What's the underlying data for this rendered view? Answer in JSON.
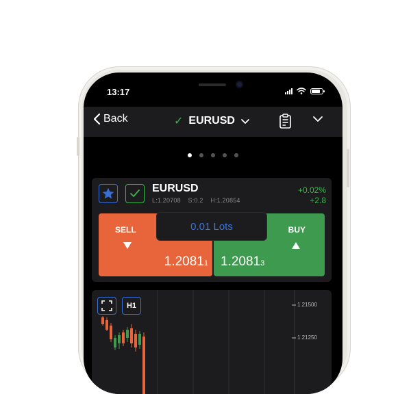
{
  "status": {
    "time": "13:17"
  },
  "nav": {
    "back_label": "Back",
    "symbol": "EURUSD"
  },
  "pager": {
    "count": 5,
    "active": 0
  },
  "card": {
    "symbol": "EURUSD",
    "low": "L:1.20708",
    "spread": "S:0.2",
    "high": "H:1.20854",
    "change_pct": "+0.02%",
    "change_pips": "+2.8",
    "sell_label": "SELL",
    "buy_label": "BUY",
    "sell_price_main": "1.2081",
    "sell_price_pip": "1",
    "buy_price_main": "1.2081",
    "buy_price_pip": "3",
    "lots": "0.01 Lots"
  },
  "chart": {
    "timeframe": "H1",
    "y_labels": [
      "1.21500",
      "1.21250"
    ]
  },
  "colors": {
    "sell": "#e8643a",
    "buy": "#3e9a4e",
    "accent_blue": "#3a74e0",
    "positive": "#3bb54a"
  }
}
